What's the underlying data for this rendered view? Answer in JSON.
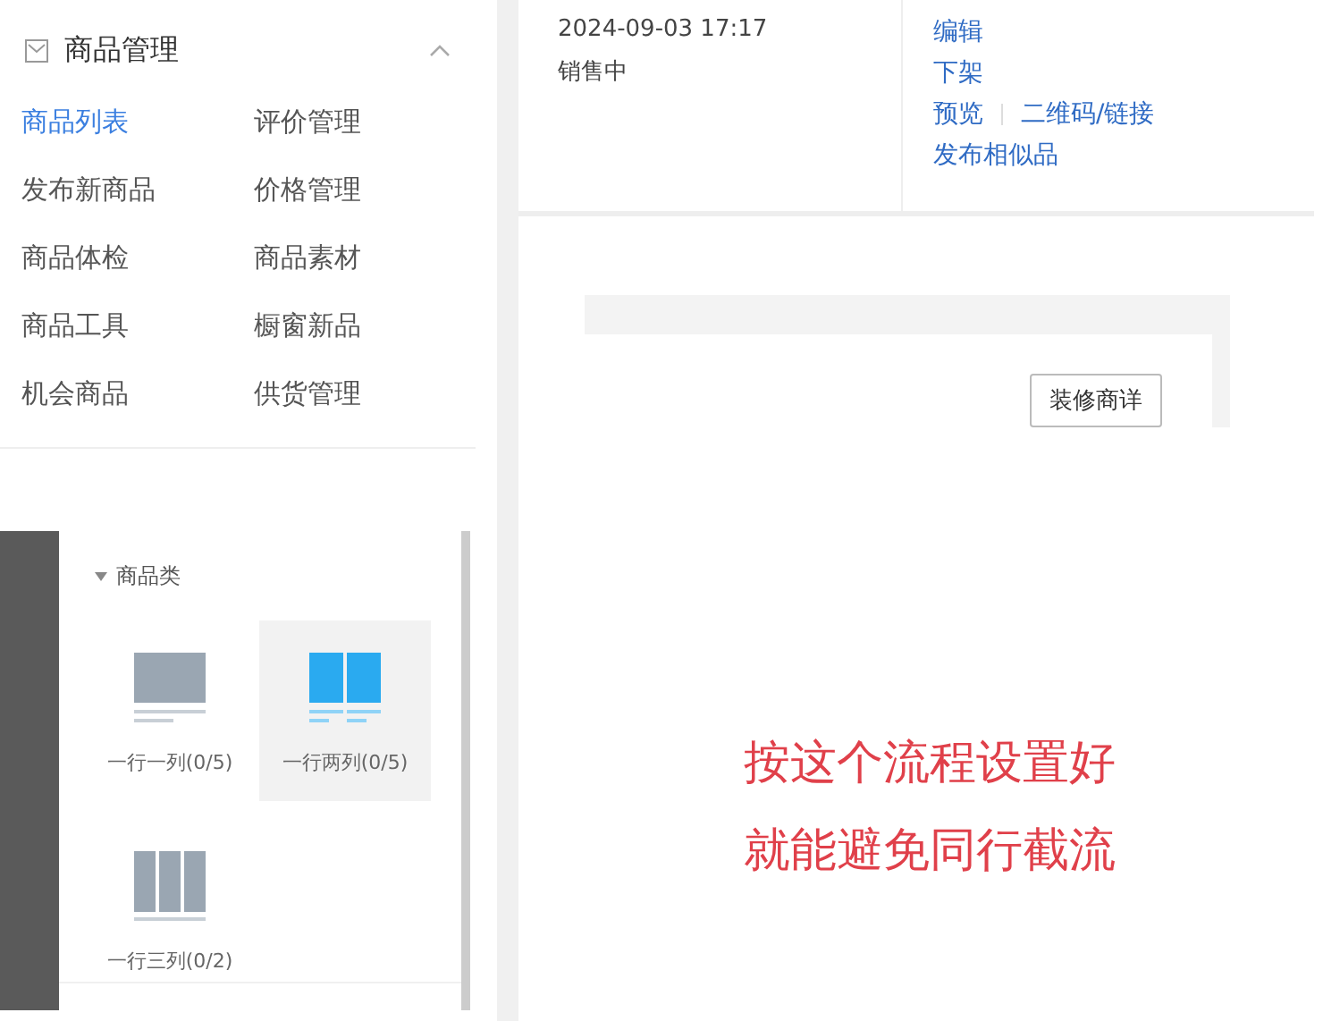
{
  "menu": {
    "title": "商品管理",
    "expanded": true,
    "items": [
      {
        "label": "商品列表",
        "selected": true
      },
      {
        "label": "评价管理",
        "selected": false
      },
      {
        "label": "发布新商品",
        "selected": false
      },
      {
        "label": "价格管理",
        "selected": false
      },
      {
        "label": "商品体检",
        "selected": false
      },
      {
        "label": "商品素材",
        "selected": false
      },
      {
        "label": "商品工具",
        "selected": false
      },
      {
        "label": "橱窗新品",
        "selected": false
      },
      {
        "label": "机会商品",
        "selected": false
      },
      {
        "label": "供货管理",
        "selected": false
      }
    ]
  },
  "module_panel": {
    "title": "商品类",
    "expanded": true,
    "layouts": [
      {
        "label": "一行一列(0/5)",
        "kind": "single",
        "selected": false
      },
      {
        "label": "一行两列(0/5)",
        "kind": "double",
        "selected": true
      },
      {
        "label": "一行三列(0/2)",
        "kind": "triple",
        "selected": false
      }
    ]
  },
  "product_row": {
    "time": "2024-09-03 17:17",
    "status": "销售中",
    "actions": [
      [
        "编辑"
      ],
      [
        "下架"
      ],
      [
        "预览",
        "二维码/链接"
      ],
      [
        "发布相似品"
      ]
    ]
  },
  "detail_card": {
    "button": "装修商详"
  },
  "annotation": [
    "按这个流程设置好",
    "就能避免同行截流"
  ]
}
